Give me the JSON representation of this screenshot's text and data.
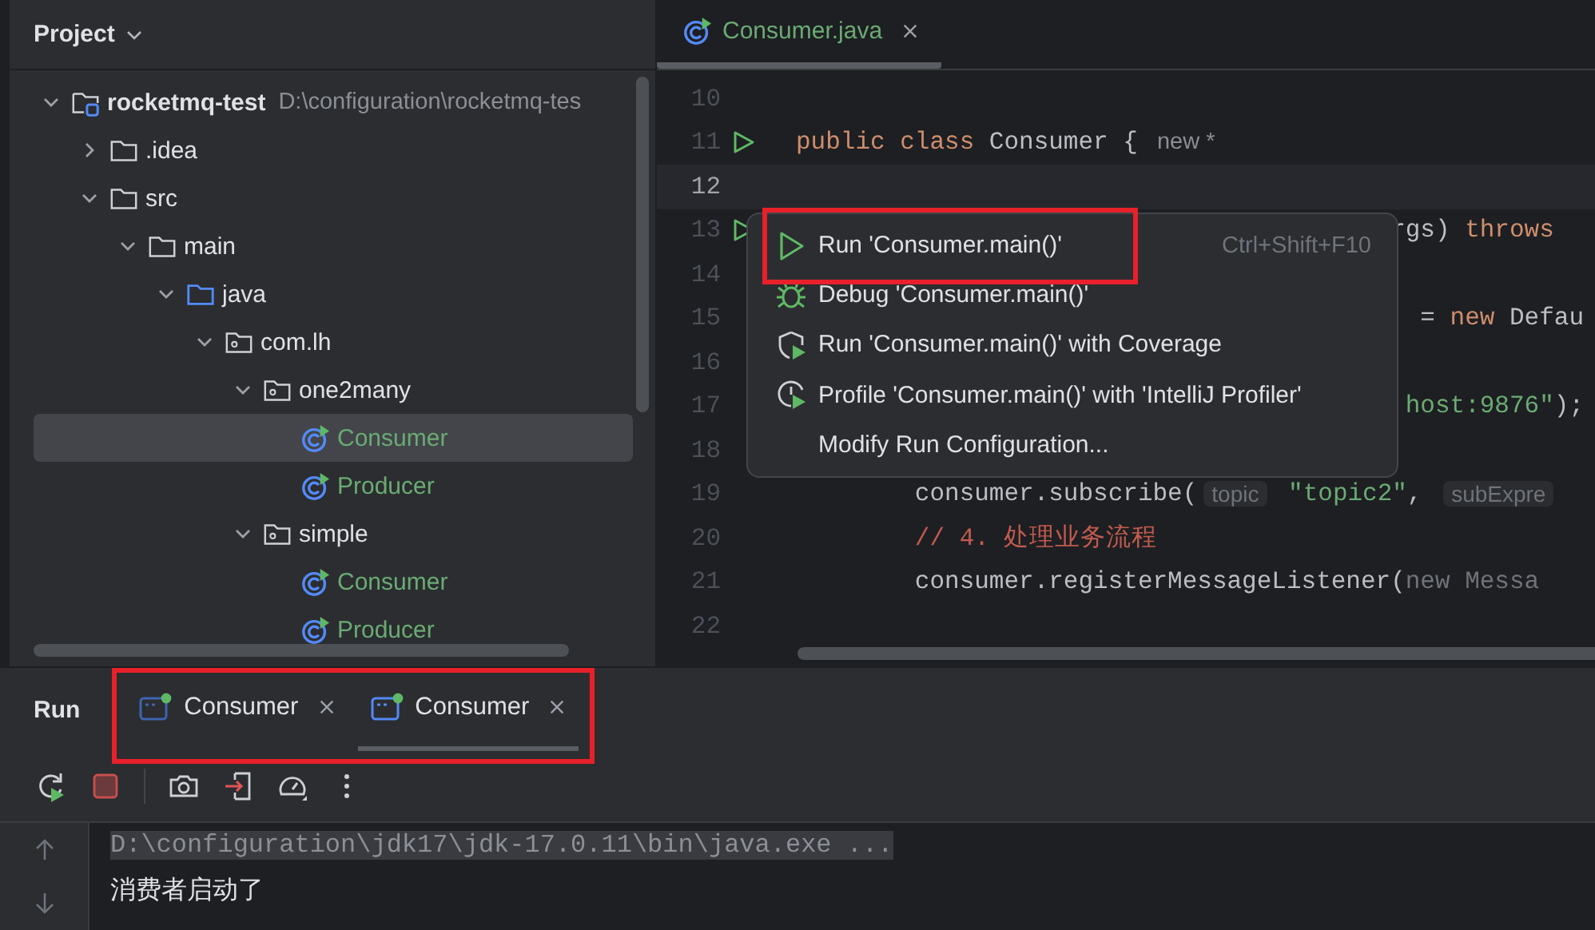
{
  "project_panel": {
    "title": "Project",
    "tree": [
      {
        "label": "rocketmq-test",
        "path": "D:\\configuration\\rocketmq-tes",
        "kind": "module",
        "expanded": true,
        "selected": false,
        "children": [
          {
            "label": ".idea",
            "kind": "folder",
            "expanded": false,
            "selected": false
          },
          {
            "label": "src",
            "kind": "folder",
            "expanded": true,
            "selected": false,
            "children": [
              {
                "label": "main",
                "kind": "folder",
                "expanded": true,
                "selected": false,
                "children": [
                  {
                    "label": "java",
                    "kind": "source",
                    "expanded": true,
                    "selected": false,
                    "children": [
                      {
                        "label": "com.lh",
                        "kind": "package",
                        "expanded": true,
                        "selected": false,
                        "children": [
                          {
                            "label": "one2many",
                            "kind": "package",
                            "expanded": true,
                            "selected": false,
                            "children": [
                              {
                                "label": "Consumer",
                                "kind": "class",
                                "selected": true
                              },
                              {
                                "label": "Producer",
                                "kind": "class",
                                "selected": false
                              }
                            ]
                          },
                          {
                            "label": "simple",
                            "kind": "package",
                            "expanded": true,
                            "selected": false,
                            "children": [
                              {
                                "label": "Consumer",
                                "kind": "class",
                                "selected": false
                              },
                              {
                                "label": "Producer",
                                "kind": "class",
                                "selected": false
                              }
                            ]
                          }
                        ]
                      }
                    ]
                  }
                ]
              }
            ]
          }
        ]
      }
    ]
  },
  "editor": {
    "tabs": [
      {
        "label": "Consumer.java",
        "selected": true
      }
    ],
    "lines": [
      {
        "number": "10",
        "run": false,
        "current": false
      },
      {
        "number": "11",
        "run": true,
        "current": false,
        "segments": [
          {
            "kind": "keyword",
            "text": "public class "
          },
          {
            "kind": "plain",
            "text": "Consumer {"
          },
          {
            "kind": "hint",
            "text": "new *"
          }
        ]
      },
      {
        "number": "12",
        "run": false,
        "current": true
      },
      {
        "number": "13",
        "run": true,
        "current": false,
        "segments": [
          {
            "kind": "plain",
            "text": "                                        rgs) "
          },
          {
            "kind": "keyword",
            "text": "throws"
          }
        ]
      },
      {
        "number": "14",
        "run": false,
        "current": false
      },
      {
        "number": "15",
        "run": false,
        "current": false,
        "segments": [
          {
            "kind": "plain",
            "text": "                                          = "
          },
          {
            "kind": "keyword",
            "text": "new "
          },
          {
            "kind": "plain",
            "text": "Defau"
          }
        ]
      },
      {
        "number": "16",
        "run": false,
        "current": false
      },
      {
        "number": "17",
        "run": false,
        "current": false,
        "segments": [
          {
            "kind": "string",
            "text": "                                         host:9876\""
          },
          {
            "kind": "plain",
            "text": ");"
          }
        ]
      },
      {
        "number": "18",
        "run": false,
        "current": false
      },
      {
        "number": "19",
        "run": false,
        "current": false,
        "segments": [
          {
            "kind": "plain",
            "text": "        consumer.subscribe("
          },
          {
            "kind": "inlay",
            "text": "topic"
          },
          {
            "kind": "string",
            "text": " \"topic2\""
          },
          {
            "kind": "plain",
            "text": ", "
          },
          {
            "kind": "inlay",
            "text": "subExpre"
          }
        ]
      },
      {
        "number": "20",
        "run": false,
        "current": false,
        "segments": [
          {
            "kind": "comment",
            "text": "        // 4. 处理业务流程"
          }
        ]
      },
      {
        "number": "21",
        "run": false,
        "current": false,
        "segments": [
          {
            "kind": "plain",
            "text": "        consumer.registerMessageListener("
          },
          {
            "kind": "dim",
            "text": "new Messa"
          }
        ]
      },
      {
        "number": "22",
        "run": false,
        "current": false
      }
    ],
    "popup_menu": [
      {
        "kind": "run",
        "label": "Run 'Consumer.main()'",
        "shortcut": "Ctrl+Shift+F10",
        "annotated": true
      },
      {
        "kind": "debug",
        "label": "Debug 'Consumer.main()'",
        "annotated": false
      },
      {
        "kind": "coverage",
        "label": "Run 'Consumer.main()' with Coverage",
        "annotated": false
      },
      {
        "kind": "profile",
        "label": "Profile 'Consumer.main()' with 'IntelliJ Profiler'",
        "annotated": false
      },
      {
        "kind": "plain",
        "label": "Modify Run Configuration...",
        "annotated": false
      }
    ]
  },
  "run_panel": {
    "title": "Run",
    "tabs_annotated": true,
    "tabs": [
      {
        "label": "Consumer",
        "selected": false
      },
      {
        "label": "Consumer",
        "selected": true
      }
    ],
    "console": [
      {
        "kind": "command",
        "text": "D:\\configuration\\jdk17\\jdk-17.0.11\\bin\\java.exe ..."
      },
      {
        "kind": "output",
        "text": "消费者启动了"
      }
    ]
  }
}
